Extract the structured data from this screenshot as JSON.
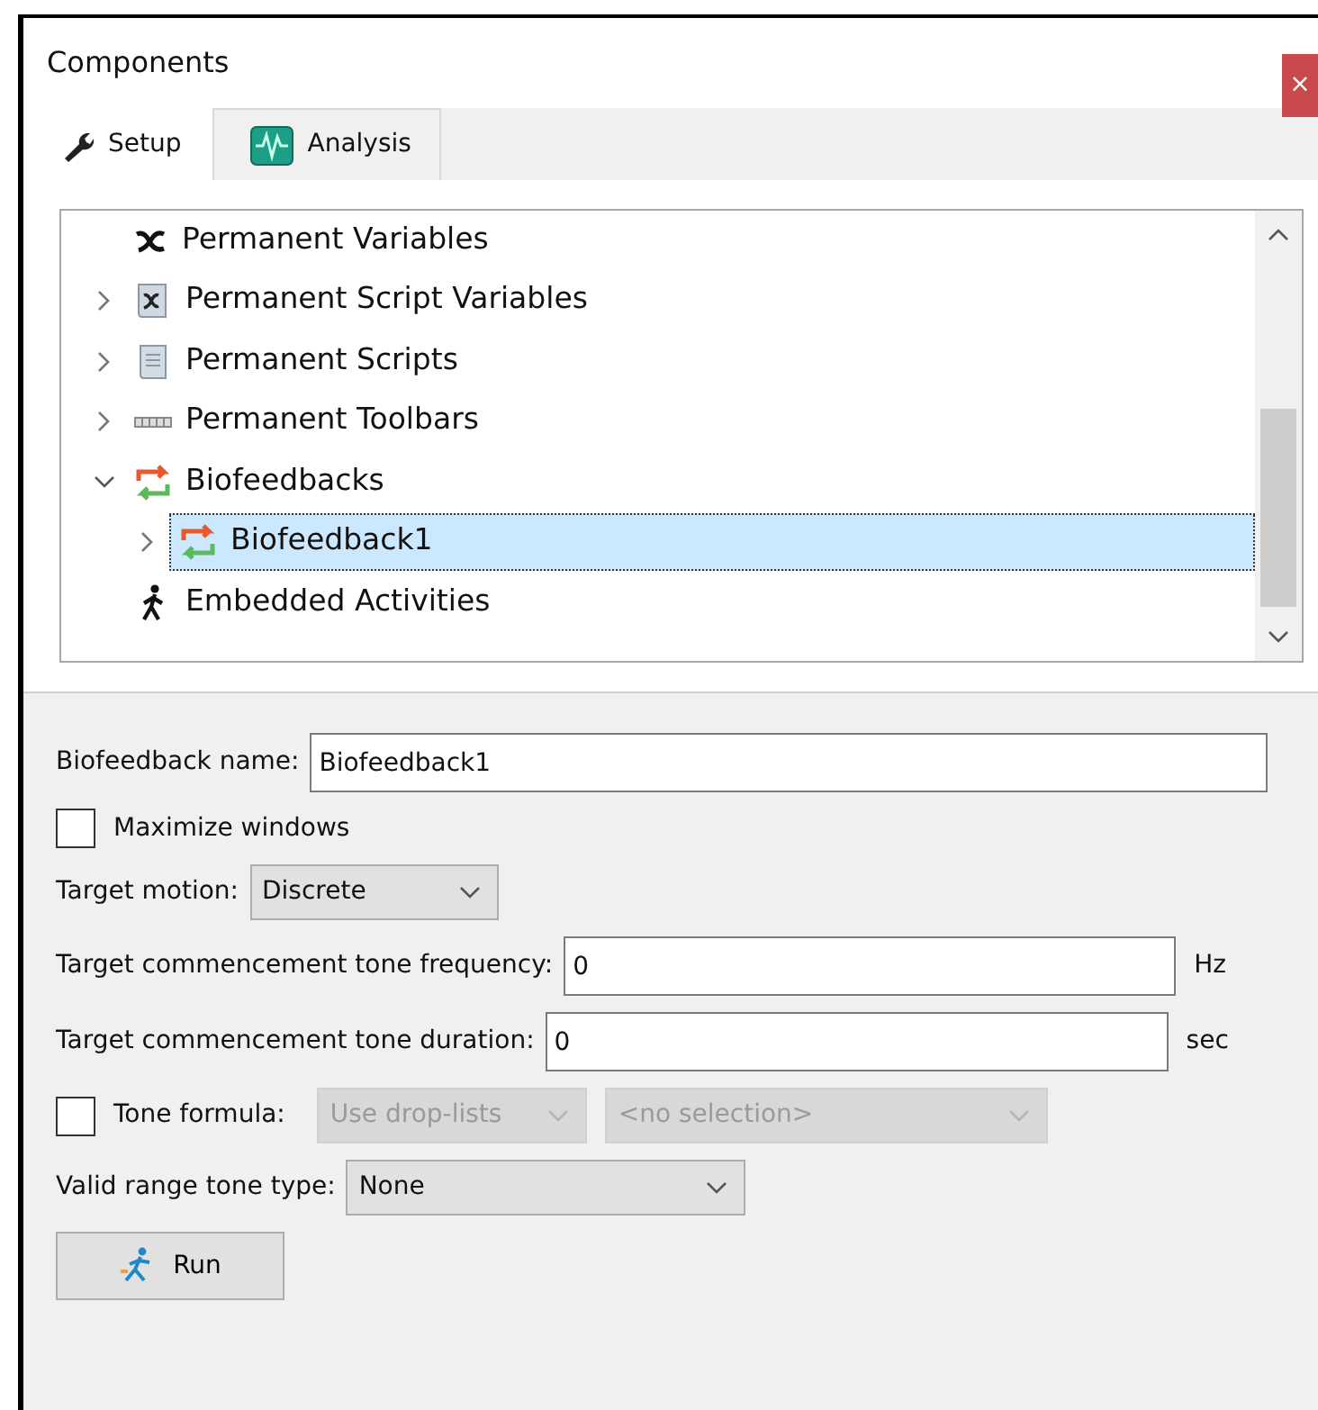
{
  "window": {
    "title": "Components",
    "close": "×"
  },
  "tabs": [
    {
      "label": "Setup",
      "kind": "wrench",
      "selected": true
    },
    {
      "label": "Analysis",
      "kind": "wave",
      "selected": false
    }
  ],
  "tree": [
    {
      "label": "Permanent Variables",
      "kind": "variable"
    },
    {
      "label": "Permanent Script Variables",
      "kind": "script-variable",
      "expanded": false
    },
    {
      "label": "Permanent Scripts",
      "kind": "script",
      "expanded": false
    },
    {
      "label": "Permanent Toolbars",
      "kind": "toolbar",
      "expanded": false
    },
    {
      "label": "Biofeedbacks",
      "kind": "loop",
      "expanded": true,
      "children": [
        {
          "label": "Biofeedback1",
          "kind": "loop",
          "expanded": false,
          "selected": true
        }
      ]
    },
    {
      "label": "Embedded Activities",
      "kind": "walker"
    }
  ],
  "form": {
    "name_label": "Biofeedback name:",
    "name_value": "Biofeedback1",
    "maximize": {
      "label": "Maximize windows",
      "checked": false
    },
    "motion_label": "Target motion:",
    "motion_value": "Discrete",
    "frequency_label": "Target commencement tone frequency:",
    "frequency_value": "0",
    "frequency_unit": "Hz",
    "duration_label": "Target commencement tone duration:",
    "duration_value": "0",
    "duration_unit": "sec",
    "tone_formula": {
      "label": "Tone formula:",
      "checked": false,
      "mode": "Use drop-lists",
      "selection": "<no selection>",
      "disabled": true
    },
    "range_label": "Valid range tone type:",
    "range_value": "None",
    "run_button": "Run"
  }
}
